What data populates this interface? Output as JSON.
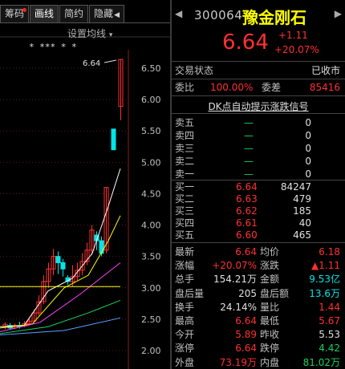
{
  "tabs": [
    {
      "label": "筹码",
      "has_dot": true
    },
    {
      "label": "画线",
      "has_dot": false
    },
    {
      "label": "简约",
      "has_dot": false
    },
    {
      "label": "隐藏",
      "has_dot": false,
      "arrow": "◀"
    }
  ],
  "ma_setting": {
    "label": "设置均线",
    "caret": "▾"
  },
  "chart": {
    "y_ticks": [
      "6.50",
      "6.00",
      "5.50",
      "5.00",
      "4.50",
      "4.00",
      "3.50",
      "3.00",
      "2.50",
      "2.00"
    ],
    "price_marker": "6.64",
    "star_markers": "*  ***  *  *",
    "colors": {
      "up": "#ff3030",
      "down": "#00e6e6",
      "ma5": "#ffffff",
      "ma10": "#ffff00",
      "ma20": "#ff40ff",
      "ma30": "#19d060",
      "ma60": "#5aa0ff"
    }
  },
  "stock": {
    "nav_prev": "◀",
    "nav_next": "▶",
    "code": "300064",
    "name": "豫金刚石",
    "price": "6.64",
    "change": "+1.11",
    "change_pct": "+20.07%"
  },
  "status": {
    "label": "交易状态",
    "value": "已收市"
  },
  "ratio": {
    "label": "委比",
    "value": "100.00%",
    "diff_label": "委差",
    "diff_value": "85416"
  },
  "dk_signal": "DK点自动提示涨跌信号",
  "sell_orders": [
    {
      "label": "卖五",
      "price": "—",
      "volume": "0"
    },
    {
      "label": "卖四",
      "price": "—",
      "volume": "0"
    },
    {
      "label": "卖三",
      "price": "—",
      "volume": "0"
    },
    {
      "label": "卖二",
      "price": "—",
      "volume": "0"
    },
    {
      "label": "卖一",
      "price": "—",
      "volume": "0"
    }
  ],
  "buy_orders": [
    {
      "label": "买一",
      "price": "6.64",
      "volume": "84247"
    },
    {
      "label": "买二",
      "price": "6.63",
      "volume": "479"
    },
    {
      "label": "买三",
      "price": "6.62",
      "volume": "185"
    },
    {
      "label": "买四",
      "price": "6.61",
      "volume": "40"
    },
    {
      "label": "买五",
      "price": "6.60",
      "volume": "465"
    }
  ],
  "stats": [
    {
      "l1": "最新",
      "v1": "6.64",
      "c1": "red",
      "l2": "均价",
      "v2": "6.18",
      "c2": "red"
    },
    {
      "l1": "涨幅",
      "v1": "+20.07%",
      "c1": "red",
      "l2": "涨跌",
      "v2": "▲1.11",
      "c2": "red"
    },
    {
      "l1": "总手",
      "v1": "154.21万",
      "c1": "white",
      "l2": "金额",
      "v2": "9.53亿",
      "c2": "cyan"
    },
    {
      "l1": "盘后量",
      "v1": "205",
      "c1": "white",
      "l2": "盘后额",
      "v2": "13.6万",
      "c2": "cyan"
    },
    {
      "l1": "换手",
      "v1": "24.14%",
      "c1": "white",
      "l2": "量比",
      "v2": "1.44",
      "c2": "red"
    },
    {
      "l1": "最高",
      "v1": "6.64",
      "c1": "red",
      "l2": "最低",
      "v2": "5.67",
      "c2": "red"
    },
    {
      "l1": "今开",
      "v1": "5.89",
      "c1": "red",
      "l2": "昨收",
      "v2": "5.53",
      "c2": "white"
    },
    {
      "l1": "涨停",
      "v1": "6.64",
      "c1": "red",
      "l2": "跌停",
      "v2": "4.42",
      "c2": "green"
    },
    {
      "l1": "外盘",
      "v1": "73.19万",
      "c1": "red",
      "l2": "内盘",
      "v2": "81.02万",
      "c2": "green"
    }
  ]
}
